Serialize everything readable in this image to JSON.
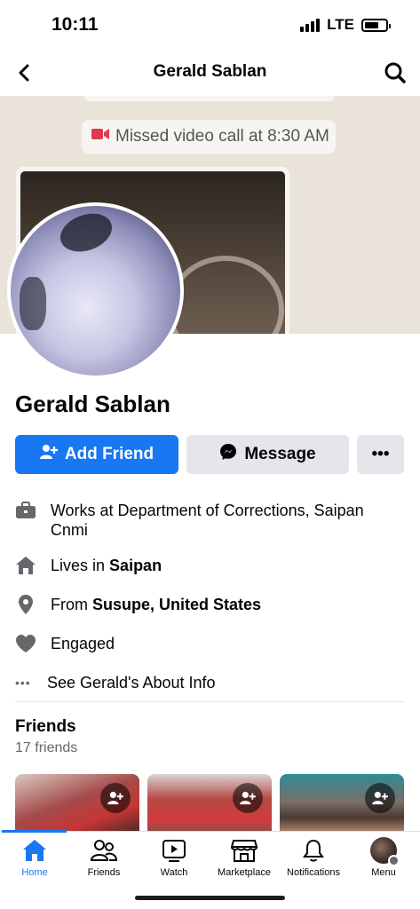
{
  "status_bar": {
    "time": "10:11",
    "network": "LTE"
  },
  "nav": {
    "title": "Gerald Sablan",
    "back_icon": "chevron-left-icon",
    "search_icon": "search-icon"
  },
  "cover": {
    "missed_call_text": "Missed video call at 8:30 AM"
  },
  "profile": {
    "name": "Gerald Sablan",
    "buttons": {
      "add_friend": "Add Friend",
      "message": "Message",
      "more": "•••"
    }
  },
  "info": {
    "work": {
      "text": "Works at Department of Corrections, Saipan Cnmi"
    },
    "lives": {
      "prefix": "Lives in ",
      "place": "Saipan"
    },
    "from": {
      "prefix": "From ",
      "place": "Susupe, United States"
    },
    "relationship": {
      "text": "Engaged"
    },
    "about": {
      "dots": "•••",
      "text": "See Gerald's About Info"
    }
  },
  "friends": {
    "title": "Friends",
    "count": "17 friends"
  },
  "tabs": [
    {
      "label": "Home",
      "icon": "home-icon",
      "active": true
    },
    {
      "label": "Friends",
      "icon": "friends-icon",
      "active": false
    },
    {
      "label": "Watch",
      "icon": "watch-icon",
      "active": false
    },
    {
      "label": "Marketplace",
      "icon": "marketplace-icon",
      "active": false
    },
    {
      "label": "Notifications",
      "icon": "bell-icon",
      "active": false
    },
    {
      "label": "Menu",
      "icon": "avatar-menu-icon",
      "active": false
    }
  ],
  "colors": {
    "accent": "#1877f2",
    "secondary_button": "#e4e6eb",
    "muted_text": "#65676b"
  }
}
